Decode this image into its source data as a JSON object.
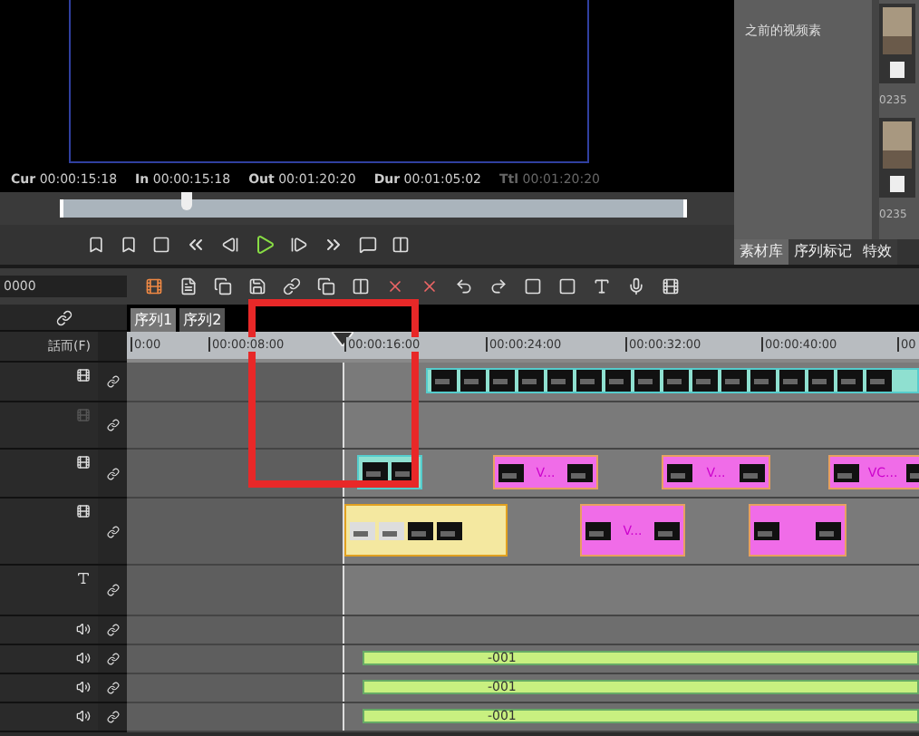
{
  "monitor": {
    "timecodes": [
      {
        "label": "Cur",
        "value": "00:00:15:18",
        "disabled": false
      },
      {
        "label": "In",
        "value": "00:00:15:18",
        "disabled": false
      },
      {
        "label": "Out",
        "value": "00:01:20:20",
        "disabled": false
      },
      {
        "label": "Dur",
        "value": "00:01:05:02",
        "disabled": false
      },
      {
        "label": "Ttl",
        "value": "00:01:20:20",
        "disabled": true
      }
    ],
    "scrubber": {
      "level": 0.19
    }
  },
  "bin": {
    "item": "之前的视频素",
    "thumbnails": [
      {
        "caption": "0235"
      },
      {
        "caption": "0235"
      }
    ],
    "tabs": [
      {
        "label": "素材库",
        "selected": true
      },
      {
        "label": "序列标记",
        "selected": false
      },
      {
        "label": "特效",
        "selected": false
      }
    ]
  },
  "timeline": {
    "timecode": "0000",
    "channel_label": "話而(F)",
    "sequence_tabs": [
      {
        "label": "序列1",
        "selected": true
      },
      {
        "label": "序列2",
        "selected": false
      }
    ],
    "ruler": [
      "0:00",
      "00:00:08:00",
      "00:00:16:00",
      "00:00:24:00",
      "00:00:32:00",
      "00:00:40:00",
      "00"
    ],
    "tracks": [
      {
        "kind": "video",
        "enabled": true,
        "clips": [
          {
            "kind": "filmstrip"
          }
        ]
      },
      {
        "kind": "video",
        "enabled": false
      },
      {
        "kind": "video",
        "enabled": true,
        "clips": [
          {
            "kind": "filmstrip"
          },
          {
            "kind": "pink",
            "label": "V..."
          },
          {
            "kind": "pink",
            "label": "V..."
          },
          {
            "kind": "pink",
            "label": "VC..."
          }
        ]
      },
      {
        "kind": "video",
        "enabled": true,
        "clips": [
          {
            "kind": "yellow"
          },
          {
            "kind": "pink",
            "label": "V..."
          },
          {
            "kind": "pink"
          }
        ]
      },
      {
        "kind": "title",
        "enabled": true
      },
      {
        "kind": "audio",
        "enabled": true
      },
      {
        "kind": "audio",
        "enabled": true,
        "clips": [
          {
            "kind": "audio",
            "label": "-001"
          }
        ]
      },
      {
        "kind": "audio",
        "enabled": true,
        "clips": [
          {
            "kind": "audio",
            "label": "-001"
          }
        ]
      },
      {
        "kind": "audio",
        "enabled": true,
        "clips": [
          {
            "kind": "audio",
            "label": "-001"
          }
        ]
      }
    ]
  }
}
